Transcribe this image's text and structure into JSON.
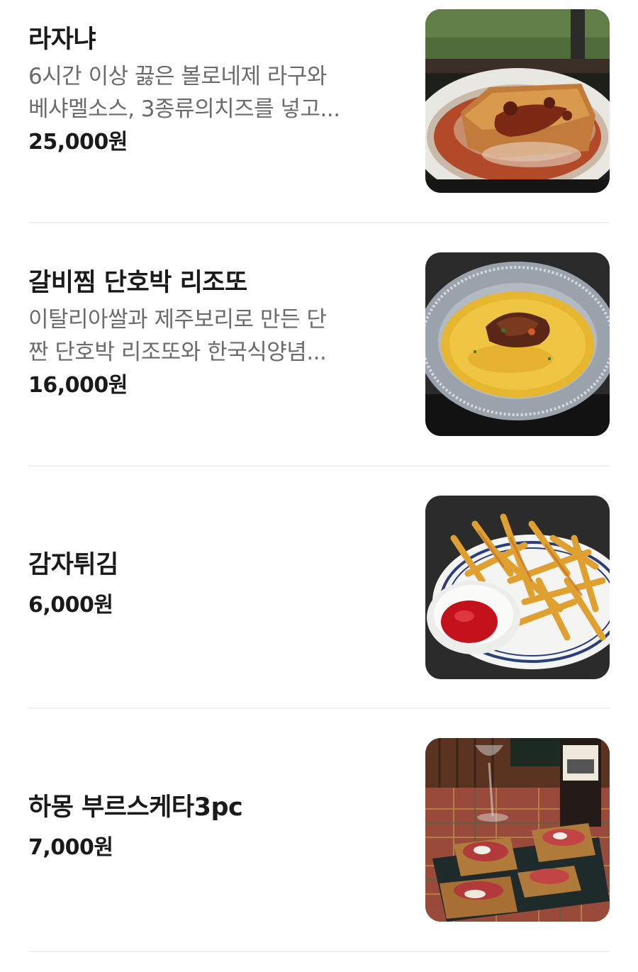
{
  "menu": {
    "items": [
      {
        "name": "라자냐",
        "desc_lines": [
          "6시간 이상 끓은 볼로네제 라구와",
          "베샤멜소스, 3종류의치즈를 넣고..."
        ],
        "price": "25,000원",
        "image": "lasagna-photo"
      },
      {
        "name": "갈비찜 단호박 리조또",
        "desc_lines": [
          "이탈리아쌀과 제주보리로 만든 단",
          "짠 단호박 리조또와 한국식양념..."
        ],
        "price": "16,000원",
        "image": "risotto-photo"
      },
      {
        "name": "감자튀김",
        "price": "6,000원",
        "image": "fries-photo"
      },
      {
        "name": "하몽 부르스케타3pc",
        "price": "7,000원",
        "image": "bruschetta-photo"
      }
    ]
  }
}
